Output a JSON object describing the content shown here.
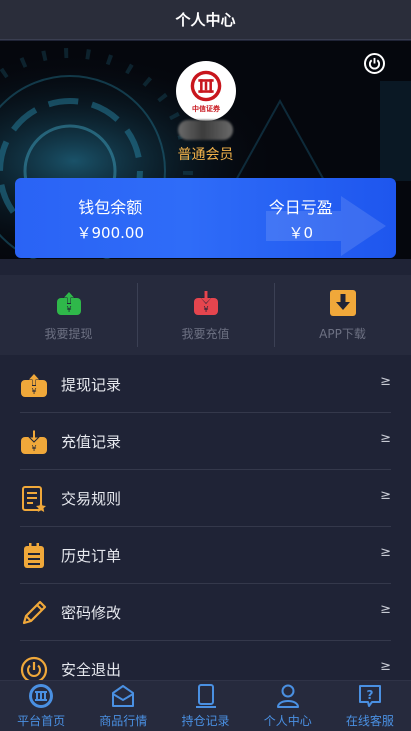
{
  "header": {
    "title": "个人中心"
  },
  "profile": {
    "avatar_text": "中信证券",
    "member_level": "普通会员"
  },
  "wallet": {
    "balance_label": "钱包余额",
    "balance_value": "￥900.00",
    "today_pnl_label": "今日亏盈",
    "today_pnl_value": "￥0"
  },
  "quick_actions": [
    {
      "label": "我要提现",
      "icon": "withdraw-icon",
      "color": "#2fb84a"
    },
    {
      "label": "我要充值",
      "icon": "deposit-icon",
      "color": "#e5454e"
    },
    {
      "label": "APP下载",
      "icon": "download-icon",
      "color": "#f0a83a"
    }
  ],
  "menu": [
    {
      "label": "提现记录",
      "icon": "withdraw-record-icon",
      "arrow": "≥"
    },
    {
      "label": "充值记录",
      "icon": "deposit-record-icon",
      "arrow": "≥"
    },
    {
      "label": "交易规则",
      "icon": "rules-icon",
      "arrow": "≥"
    },
    {
      "label": "历史订单",
      "icon": "orders-icon",
      "arrow": "≥"
    },
    {
      "label": "密码修改",
      "icon": "password-edit-icon",
      "arrow": "≥"
    },
    {
      "label": "安全退出",
      "icon": "logout-icon",
      "arrow": "≥"
    }
  ],
  "bottom_nav": [
    {
      "label": "平台首页",
      "icon": "home-logo-icon"
    },
    {
      "label": "商品行情",
      "icon": "market-icon"
    },
    {
      "label": "持仓记录",
      "icon": "positions-icon"
    },
    {
      "label": "个人中心",
      "icon": "profile-icon"
    },
    {
      "label": "在线客服",
      "icon": "support-icon"
    }
  ],
  "colors": {
    "accent_orange": "#f2b24a",
    "nav_blue": "#4a90e2",
    "card_blue": "#2f6cf8",
    "background": "#1f2336"
  }
}
